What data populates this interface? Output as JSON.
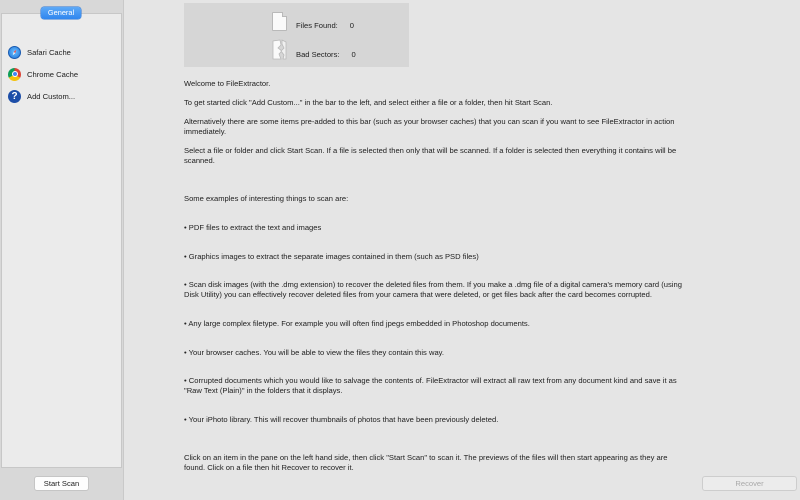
{
  "sidebar": {
    "tab_label": "General",
    "items": [
      {
        "label": "Safari Cache",
        "icon": "safari-icon"
      },
      {
        "label": "Chrome Cache",
        "icon": "chrome-icon"
      },
      {
        "label": "Add Custom...",
        "icon": "help-icon"
      }
    ],
    "start_scan_label": "Start Scan"
  },
  "stats": {
    "files_found_label": "Files Found:",
    "files_found_value": "0",
    "bad_sectors_label": "Bad Sectors:",
    "bad_sectors_value": "0"
  },
  "main": {
    "welcome": "Welcome to FileExtractor.",
    "getting_started": "To get started click \"Add Custom...\" in the bar to the left, and select either a file or a folder, then hit Start Scan.",
    "alternatively": "Alternatively there are some items pre-added to this bar (such as your browser caches) that you can scan if you want to see FileExtractor in action immediately.",
    "select_info": "Select a file or folder and click Start Scan. If a file is selected then only that will be scanned. If a folder is selected then everything it contains will be scanned.",
    "examples_heading": "Some examples of interesting things to scan are:",
    "examples": [
      "• PDF files to extract the text and images",
      "• Graphics images to extract the separate images contained in them (such as PSD files)",
      "• Scan disk images (with the .dmg extension) to recover the deleted files from them. If you make a .dmg file of a digital camera's memory card (using Disk Utility) you can effectively recover deleted files from your camera that were deleted, or get files back after the card becomes corrupted.",
      "• Any large complex filetype. For example you will often find jpegs embedded in Photoshop documents.",
      "• Your browser caches. You will be able to view the files they contain this way.",
      "• Corrupted documents which you would like to salvage the contents of. FileExtractor will extract all raw text from any document kind and save it as \"Raw Text (Plain)\" in the folders that it displays.",
      "• Your iPhoto library. This will recover thumbnails of photos that have been previously deleted."
    ],
    "closing": "Click on an item in the pane on the left hand side, then click \"Start Scan\" to scan it. The previews of the files will then start appearing as they are found. Click on a file then hit Recover to recover it."
  },
  "recover_label": "Recover",
  "colors": {
    "accent": "#2f86ef",
    "background": "#e5e5e5",
    "sidebar": "#ebebeb",
    "disabled_text": "#a9a9a9"
  }
}
